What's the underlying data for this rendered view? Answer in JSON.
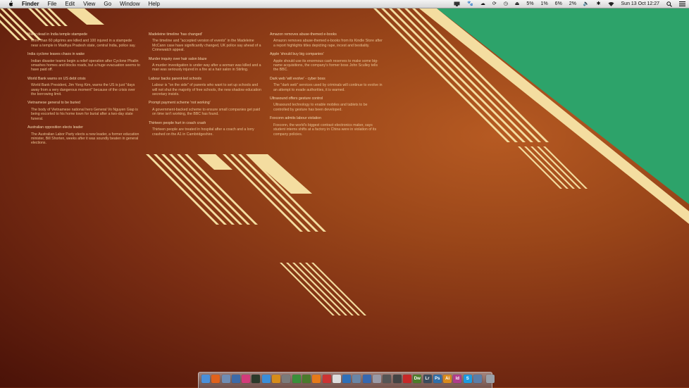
{
  "menubar": {
    "app": "Finder",
    "items": [
      "File",
      "Edit",
      "View",
      "Go",
      "Window",
      "Help"
    ],
    "status": {
      "cpu1": "5%",
      "cpu2": "1%",
      "cpu3": "6%",
      "cpu4": "2%",
      "clock": "Sun 13 Oct  12:27"
    }
  },
  "news": {
    "col1": [
      {
        "title": "Many dead in India temple stampede",
        "summary": "More than 60 pilgrims are killed and 100 injured in a stampede near a temple in Madhya Pradesh state, central India, police say."
      },
      {
        "title": "India cyclone leaves chaos in wake",
        "summary": "Indian disaster teams begin a relief operation after Cyclone Phailin smashes homes and blocks roads, but a huge evacuation seems to have paid off."
      },
      {
        "title": "World Bank warns on US debt crisis",
        "summary": "World Bank President, Jim Yong Kim, warns the US is just \"days away from a very dangerous moment\" because of the crisis over the borrowing limit."
      },
      {
        "title": "Vietnamese general to be buried",
        "summary": "The body of Vietnamese national hero General Vo Nguyen Giap is being escorted to his home town for burial after a two-day state funeral."
      },
      {
        "title": "Australian opposition elects leader",
        "summary": "The Australian Labor Party elects a new leader, a former education minister, Bill Shorten, weeks after it was soundly beaten in general elections."
      }
    ],
    "col2": [
      {
        "title": "Madeleine timeline 'has changed'",
        "summary": "The timeline and \"accepted version of events\" in the Madeleine McCann case have significantly changed, UK police say ahead of a Crimewatch appeal."
      },
      {
        "title": "Murder inquiry over hair salon blaze",
        "summary": "A murder investigation is under way after a woman was killed and a man was seriously injured in a fire at a hair salon in Stirling."
      },
      {
        "title": "Labour backs parent-led schools",
        "summary": "Labour is \"on the side\" of parents who want to set up schools and will not shut the majority of free schools, the new shadow education secretary insists."
      },
      {
        "title": "Prompt payment scheme 'not working'",
        "summary": "A government-backed scheme to ensure small companies get paid on time isn't working, the BBC has found."
      },
      {
        "title": "Thirteen people hurt in coach crash",
        "summary": "Thirteen people are treated in hospital after a coach and a lorry crashed on the A1 in Cambridgeshire."
      }
    ],
    "col3": [
      {
        "title": "Amazon removes abuse-themed e-books",
        "summary": "Amazon removes abuse-themed e-books from its Kindle Store after a report highlights titles depicting rape, incest and bestiality."
      },
      {
        "title": "Apple 'should buy big companies'",
        "summary": "Apple should use its enormous cash reserves to make some big-name acquisitions, the company's former boss John Sculley tells the BBC."
      },
      {
        "title": "Dark web 'will evolve' - cyber boss",
        "summary": "The \"dark web\" services used by criminals will continue to evolve in an attempt to evade authorities, it is warned."
      },
      {
        "title": "Ultrasound offers gesture control",
        "summary": "Ultrasound technology to enable mobiles and tablets to be controlled by gesture has been developed."
      },
      {
        "title": "Foxconn admits labour violation",
        "summary": "Foxconn, the world's biggest contract electronics maker, says student interns shifts at a factory in China were in violation of its company policies."
      }
    ]
  },
  "dock": {
    "apps": [
      {
        "name": "finder",
        "label": "",
        "color": "#4a8fd9"
      },
      {
        "name": "firefox",
        "label": "",
        "color": "#e0621c"
      },
      {
        "name": "mail",
        "label": "",
        "color": "#6f8db4"
      },
      {
        "name": "preview",
        "label": "",
        "color": "#3c6aa8"
      },
      {
        "name": "itunes",
        "label": "",
        "color": "#d33b7a"
      },
      {
        "name": "terminal",
        "label": "",
        "color": "#2b3a2b"
      },
      {
        "name": "safari",
        "label": "",
        "color": "#3b8ed8"
      },
      {
        "name": "vlc-like",
        "label": "",
        "color": "#d68c1a"
      },
      {
        "name": "system-preferences",
        "label": "",
        "color": "#7b7b7b"
      },
      {
        "name": "bolt",
        "label": "",
        "color": "#3a8f3a"
      },
      {
        "name": "transmission",
        "label": "",
        "color": "#4a7a2c"
      },
      {
        "name": "vlc",
        "label": "",
        "color": "#e67a1a"
      },
      {
        "name": "textedit",
        "label": "",
        "color": "#c33"
      },
      {
        "name": "notes",
        "label": "",
        "color": "#ddd"
      },
      {
        "name": "xcode",
        "label": "",
        "color": "#2f70b8"
      },
      {
        "name": "disk-utility",
        "label": "",
        "color": "#6a86a6"
      },
      {
        "name": "network-utility",
        "label": "",
        "color": "#3668b0"
      },
      {
        "name": "script-editor",
        "label": "",
        "color": "#9a9aa6"
      },
      {
        "name": "address-book",
        "label": "",
        "color": "#555"
      },
      {
        "name": "photo-tool",
        "label": "",
        "color": "#444"
      },
      {
        "name": "filezilla",
        "label": "",
        "color": "#c62828"
      },
      {
        "name": "dreamweaver",
        "label": "Dw",
        "color": "#4d7d2a"
      },
      {
        "name": "lightroom",
        "label": "Lr",
        "color": "#3b4c5c"
      },
      {
        "name": "photoshop",
        "label": "Ps",
        "color": "#2f6ea8"
      },
      {
        "name": "illustrator",
        "label": "Ai",
        "color": "#d88a1c"
      },
      {
        "name": "indesign",
        "label": "Id",
        "color": "#b03c8c"
      },
      {
        "name": "skype",
        "label": "S",
        "color": "#1c9be0"
      },
      {
        "name": "display",
        "label": "",
        "color": "#5a7ea8"
      },
      {
        "name": "trash",
        "label": "",
        "color": "#9aa0a8"
      }
    ]
  }
}
